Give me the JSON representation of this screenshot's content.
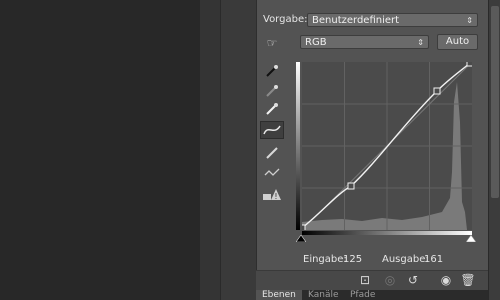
{
  "adjustments": {
    "preset_label": "Vorgabe:",
    "preset_value": "Benutzerdefiniert",
    "channel_value": "RGB",
    "auto_label": "Auto"
  },
  "curve": {
    "input_label": "Eingabe:",
    "input_value": "125",
    "output_label": "Ausgabe:",
    "output_value": "161"
  },
  "tabs": [
    {
      "label": "Ebenen"
    },
    {
      "label": "Kanäle"
    },
    {
      "label": "Pfade"
    }
  ],
  "icons": {
    "hand_tool": "hand-icon",
    "eyedropper_black": "eyedropper-black-icon",
    "eyedropper_gray": "eyedropper-gray-icon",
    "eyedropper_white": "eyedropper-white-icon",
    "curve_tool": "curve-icon",
    "pencil_tool": "pencil-icon",
    "smooth_tool": "smooth-icon",
    "clipping_warning": "warning-icon"
  }
}
